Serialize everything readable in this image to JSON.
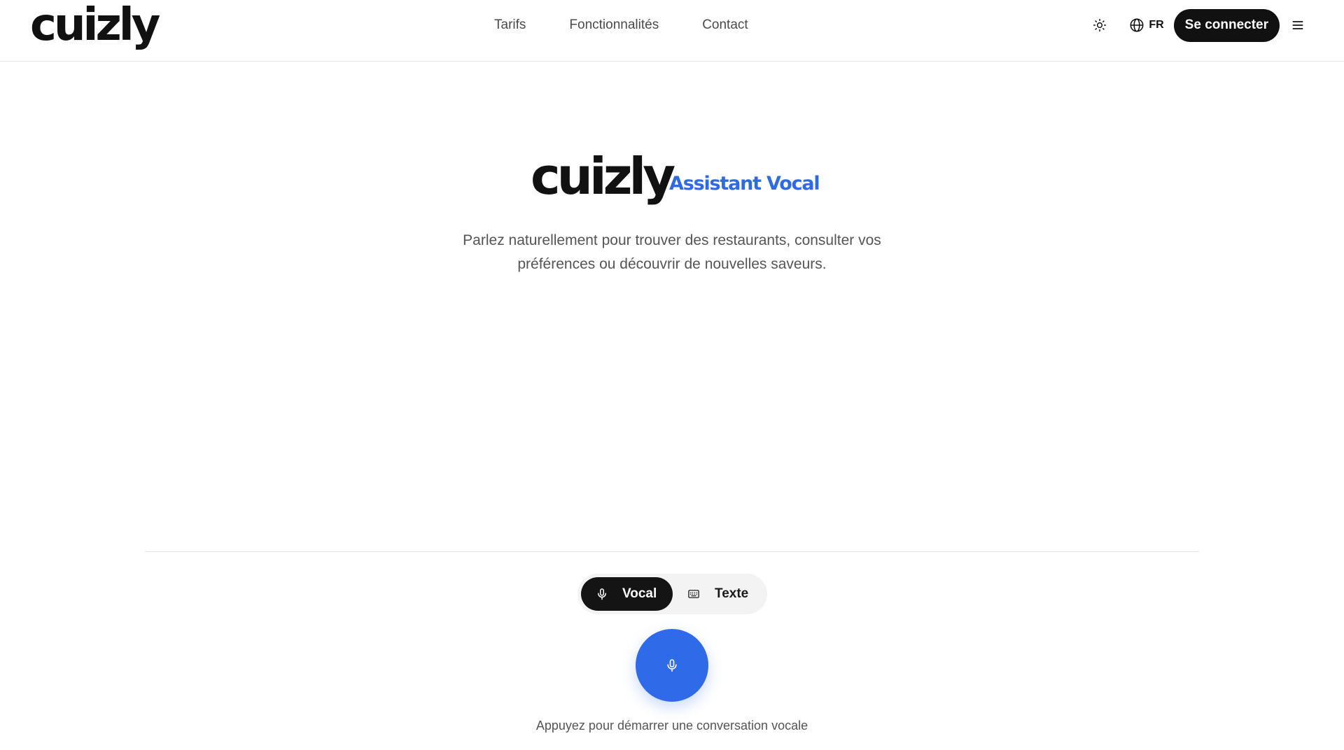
{
  "header": {
    "brand": "cuizly",
    "nav": [
      "Tarifs",
      "Fonctionnalités",
      "Contact"
    ],
    "language": "FR",
    "login_label": "Se connecter"
  },
  "hero": {
    "brand": "cuizly",
    "tagline": "Assistant Vocal",
    "intro_line1": "Parlez naturellement pour trouver des restaurants, consulter vos",
    "intro_line2": "préférences ou découvrir de nouvelles saveurs."
  },
  "modes": {
    "voice_label": "Vocal",
    "text_label": "Texte",
    "selected": "Vocal"
  },
  "hint": "Appuyez pour démarrer une conversation vocale",
  "icons": [
    "sun-icon",
    "globe-icon",
    "menu-icon",
    "microphone-icon",
    "keyboard-icon"
  ],
  "colors": {
    "accent": "#2f6ae8",
    "dark": "#111111"
  }
}
